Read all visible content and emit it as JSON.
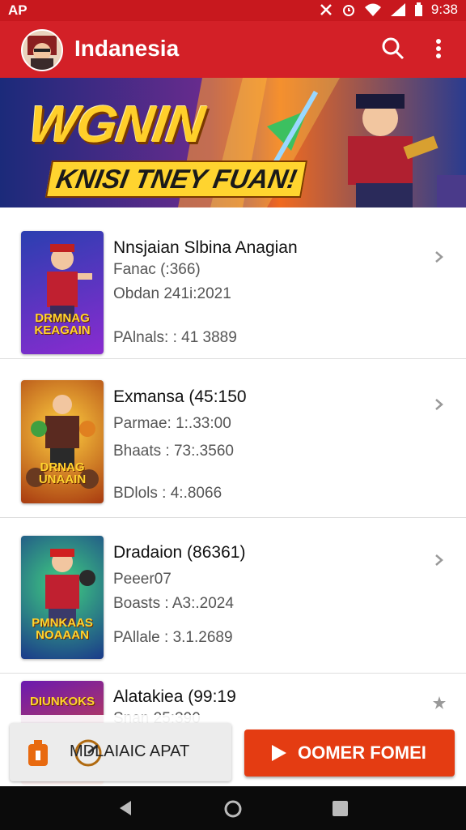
{
  "status_bar": {
    "left_text": "AP",
    "time": "9:38"
  },
  "app_bar": {
    "title": "Indanesia",
    "search_icon": "search-icon",
    "more_icon": "more-vert-icon"
  },
  "banner": {
    "headline": "WGNIN",
    "subline": "KNISI TNEY FUAN!"
  },
  "list": {
    "items": [
      {
        "title": "Nnsjaian Slbina Anagian",
        "line1": "Fanac (:366)",
        "line2": "Obdan 241i:2021",
        "line3": "PAlnals: : 41 3889",
        "thumb_label": "DRMNAG KEAGAIN",
        "thumb_colors": [
          "#2a3fb0",
          "#8a2bd0"
        ]
      },
      {
        "title": "Exmansa (45:150",
        "line1": "Parmae: 1:.33:00",
        "line2": "Bhaats : 73:.3560",
        "line3": "BDlols : 4:.8066",
        "thumb_label": "DRNAG UNAAIN",
        "thumb_colors": [
          "#f0a020",
          "#7a2a10"
        ]
      },
      {
        "title": "Dradaion (86361)",
        "line1": "Peeer07",
        "line2": "Boasts : A3:.2024",
        "line3": "PAllale : 3.1.2689",
        "thumb_label": "PMNKAAS NOAAAN",
        "thumb_colors": [
          "#1fa060",
          "#1a4a8a"
        ]
      },
      {
        "title": "Alatakiea (99:19",
        "line1": "Snan 25:390",
        "line2": "",
        "line3": "",
        "thumb_label": "DIUNKOKS",
        "thumb_colors": [
          "#6a1ab0",
          "#f05020"
        ]
      }
    ]
  },
  "bottom_sheet": {
    "left_button_label": "MDLAIAIC APAT",
    "right_button_label": "OOMER FOMEI",
    "left_icon": "battery-icon",
    "right_icon": "play-icon"
  },
  "nav_bar": {
    "back_icon": "back-icon",
    "home_icon": "home-icon",
    "recents_icon": "recents-icon"
  }
}
